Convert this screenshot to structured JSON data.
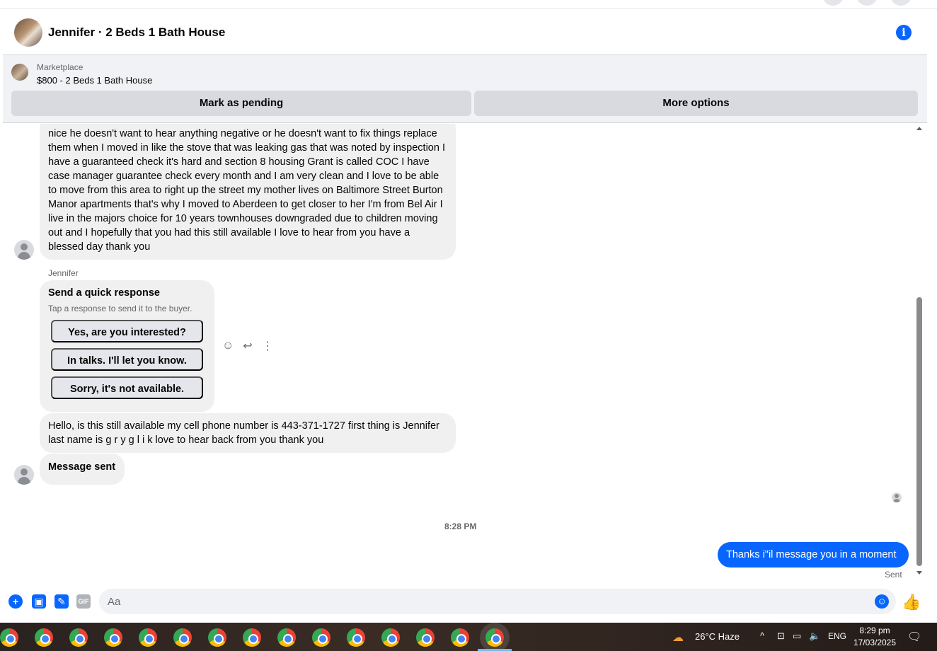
{
  "header": {
    "title": "Jennifer · 2 Beds 1 Bath House",
    "info_icon": "i"
  },
  "marketplace": {
    "label": "Marketplace",
    "listing": "$800 - 2 Beds 1 Bath House",
    "mark_pending_label": "Mark as pending",
    "more_options_label": "More options"
  },
  "messages": {
    "long_message": "nice he doesn't want to hear anything negative or he doesn't want to fix things replace them when I moved in like the stove that was leaking gas that was noted by inspection I have a guaranteed check it's hard and section 8 housing Grant is called COC I have case manager guarantee check every month and I am very clean and I love to be able to move from this area to right up the street my mother lives on Baltimore Street Burton Manor apartments that's why I moved to Aberdeen to get closer to her I'm from Bel Air I live in the majors choice for 10 years townhouses downgraded due to children moving out and I hopefully that you had this still available I love to hear from you have a blessed day thank you",
    "sender_name": "Jennifer",
    "quick_response": {
      "title": "Send a quick response",
      "subtitle": "Tap a response to send it to the buyer.",
      "options": [
        "Yes, are you interested?",
        "In talks. I'll let you know.",
        "Sorry, it's not available."
      ]
    },
    "first_message": "Hello, is this still available my cell phone number is 443-371-1727 first thing is Jennifer last name is g r y g l i k love to hear back from you thank you",
    "system_message": "Message sent",
    "timestamp": "8:28 PM",
    "sent_message": "Thanks i\"il message you in a moment",
    "sent_status": "Sent"
  },
  "composer": {
    "placeholder": "Aa",
    "gif_label": "GIF"
  },
  "taskbar": {
    "weather": "26°C  Haze",
    "language": "ENG",
    "time": "8:29 pm",
    "date": "17/03/2025"
  },
  "colors": {
    "accent": "#0866ff",
    "bubble_gray": "#f0f0f0",
    "button_gray": "#d8dadf"
  }
}
